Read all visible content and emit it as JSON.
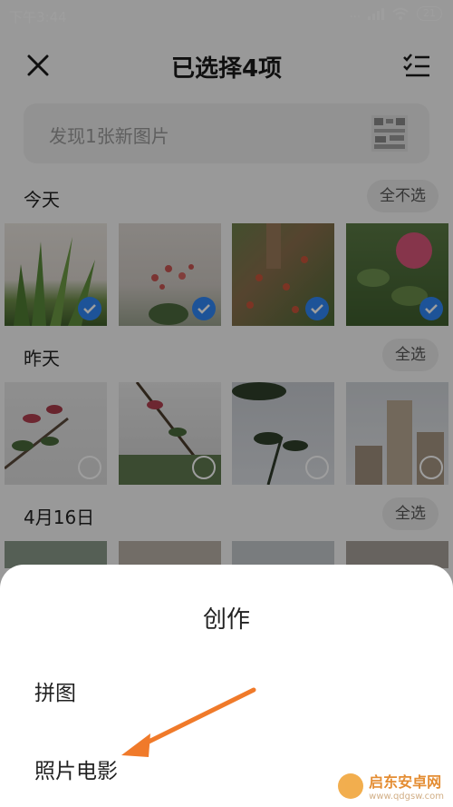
{
  "status_bar": {
    "time": "下午3:44",
    "network": "...",
    "battery": "21"
  },
  "header": {
    "title": "已选择4项"
  },
  "search": {
    "placeholder": "发现1张新图片"
  },
  "sections": [
    {
      "title": "今天",
      "action": "全不选"
    },
    {
      "title": "昨天",
      "action": "全选"
    },
    {
      "title": "4月16日",
      "action": "全选"
    }
  ],
  "photos": {
    "today": [
      {
        "checked": true
      },
      {
        "checked": true
      },
      {
        "checked": true
      },
      {
        "checked": true
      }
    ],
    "yesterday": [
      {
        "checked": false
      },
      {
        "checked": false
      },
      {
        "checked": false
      },
      {
        "checked": false
      }
    ]
  },
  "sheet": {
    "title": "创作",
    "items": [
      "拼图",
      "照片电影"
    ]
  },
  "watermark": {
    "name": "启东安卓网",
    "url": "www.qdgsw.com"
  },
  "colors": {
    "accent": "#2f86f6",
    "arrow": "#f07a2a"
  }
}
